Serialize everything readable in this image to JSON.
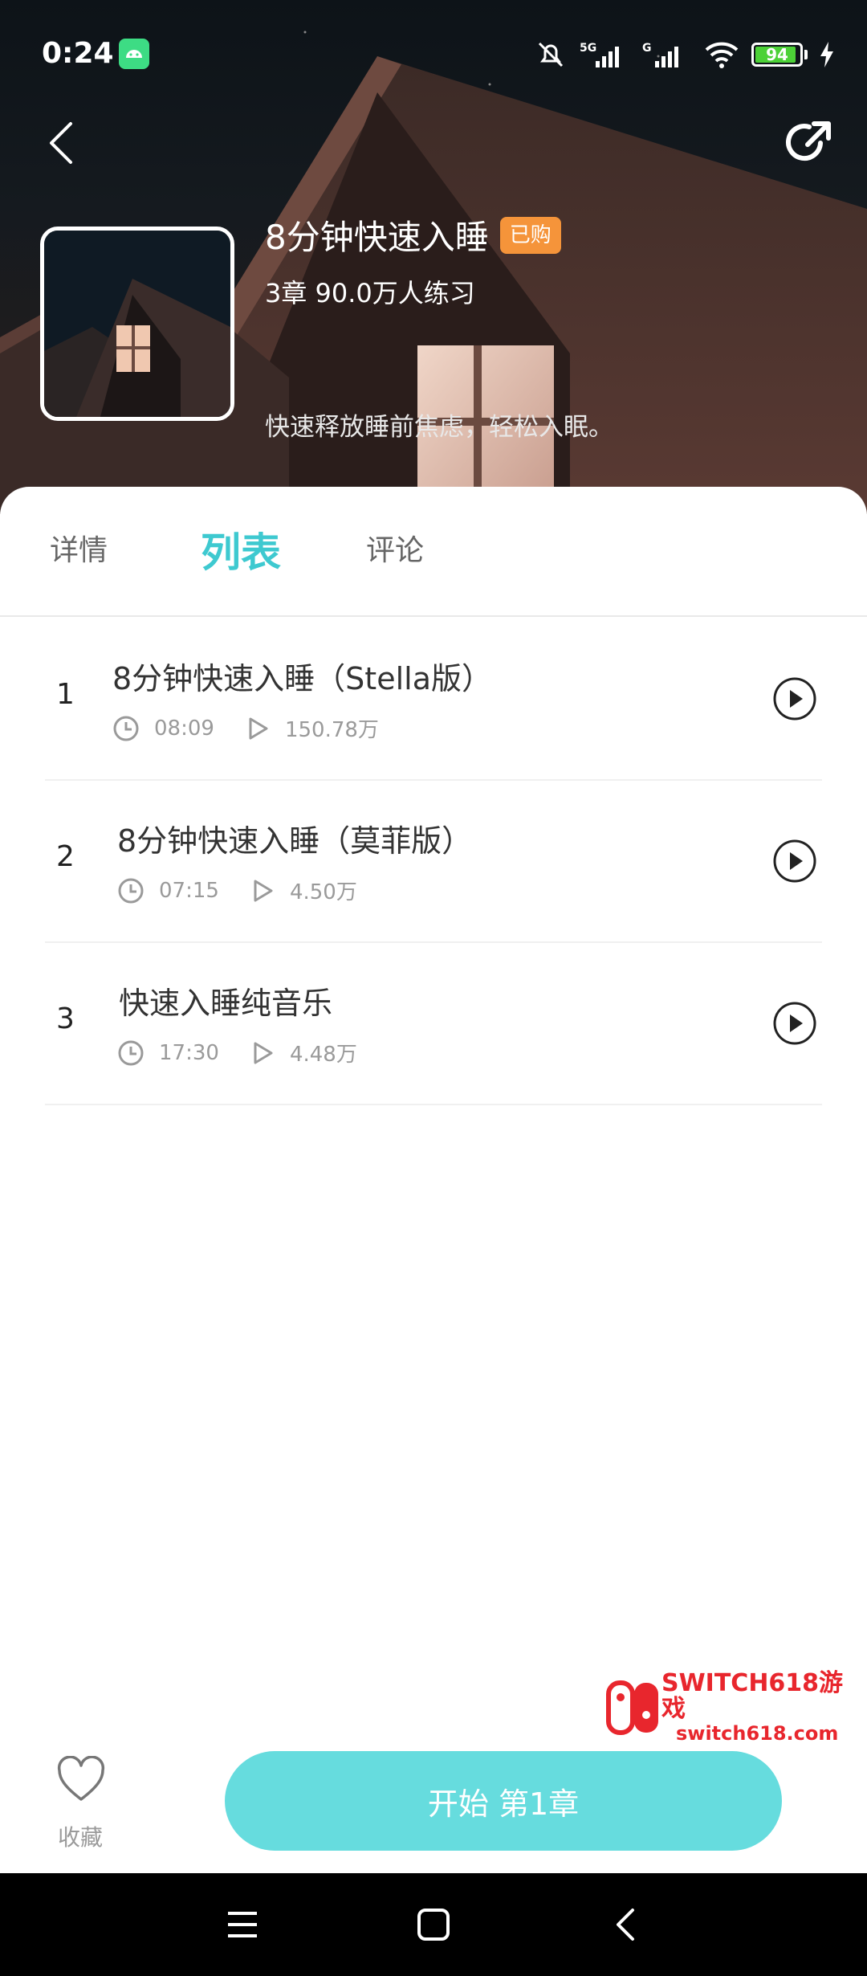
{
  "status_bar": {
    "time": "0:24",
    "battery": "94",
    "network_1": "5G",
    "network_2": "G"
  },
  "album": {
    "title": "8分钟快速入睡",
    "badge": "已购",
    "meta": "3章 90.0万人练习",
    "description": "快速释放睡前焦虑，轻松入眠。"
  },
  "tabs": [
    {
      "label": "详情",
      "active": false
    },
    {
      "label": "列表",
      "active": true
    },
    {
      "label": "评论",
      "active": false
    }
  ],
  "tracks": [
    {
      "index": "1",
      "title": "8分钟快速入睡（Stella版）",
      "duration": "08:09",
      "plays": "150.78万"
    },
    {
      "index": "2",
      "title": "8分钟快速入睡（莫菲版）",
      "duration": "07:15",
      "plays": "4.50万"
    },
    {
      "index": "3",
      "title": "快速入睡纯音乐",
      "duration": "17:30",
      "plays": "4.48万"
    }
  ],
  "bottom": {
    "favorite_label": "收藏",
    "start_button": "开始 第1章"
  },
  "watermark": {
    "line1": "SWITCH618游戏",
    "line2": "switch618.com"
  },
  "colors": {
    "accent": "#3ec9d0",
    "start_button": "#66dcde",
    "badge": "#f5943a",
    "watermark": "#e8262d"
  }
}
